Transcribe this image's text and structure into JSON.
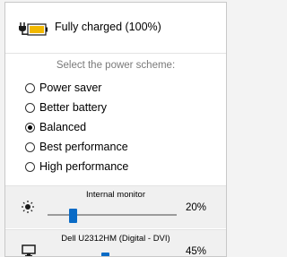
{
  "status": {
    "text": "Fully charged (100%)",
    "icon": "battery-plugged-icon"
  },
  "power_schemes": {
    "title": "Select the power scheme:",
    "options": [
      {
        "label": "Power saver",
        "selected": false
      },
      {
        "label": "Better battery",
        "selected": false
      },
      {
        "label": "Balanced",
        "selected": true
      },
      {
        "label": "Best performance",
        "selected": false
      },
      {
        "label": "High performance",
        "selected": false
      }
    ]
  },
  "monitors": [
    {
      "name": "Internal monitor",
      "brightness_label": "20%",
      "brightness_value": 20,
      "icon": "sun-icon"
    },
    {
      "name": "Dell U2312HM (Digital - DVI)",
      "brightness_label": "45%",
      "brightness_value": 45,
      "icon": "monitor-icon"
    }
  ],
  "colors": {
    "accent": "#0a6bc6",
    "battery_fill": "#f2b800",
    "plug": "#1a1a1a"
  }
}
